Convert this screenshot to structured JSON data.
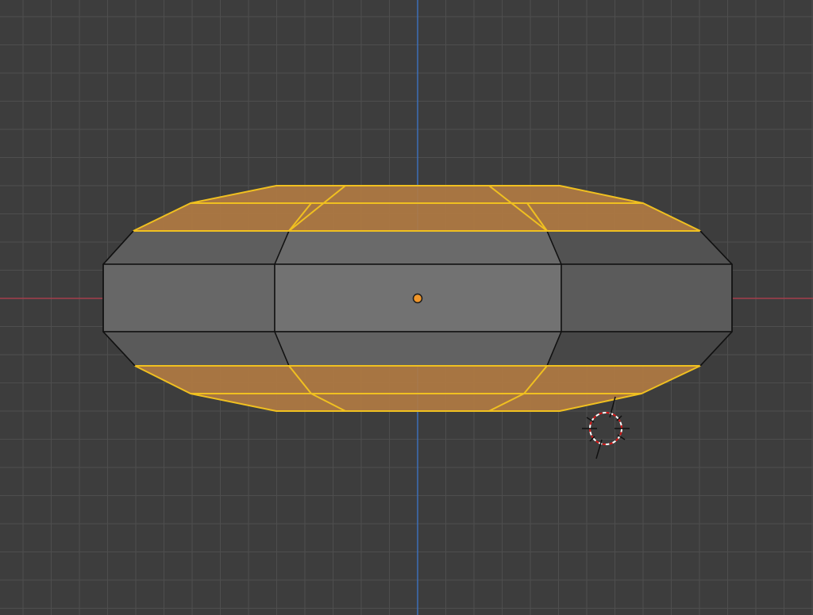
{
  "viewport": {
    "background_color": "#3d3d3d",
    "grid_color": "#4e4e4e",
    "x_axis_color": "#a33f4c",
    "y_axis_color": "#3d6fb8"
  },
  "mesh": {
    "object_type": "cylinder-mesh",
    "mode": "edit-mode-face-select",
    "selected_faces": "top-and-bottom",
    "face_color": "#6e6e6e",
    "edge_color": "#111111",
    "selected_face_color": "#b07a42",
    "selected_edge_color": "#f0c020"
  },
  "origin": {
    "color": "#f0962a"
  },
  "cursor_3d": {
    "icon": "3d-cursor-icon"
  }
}
